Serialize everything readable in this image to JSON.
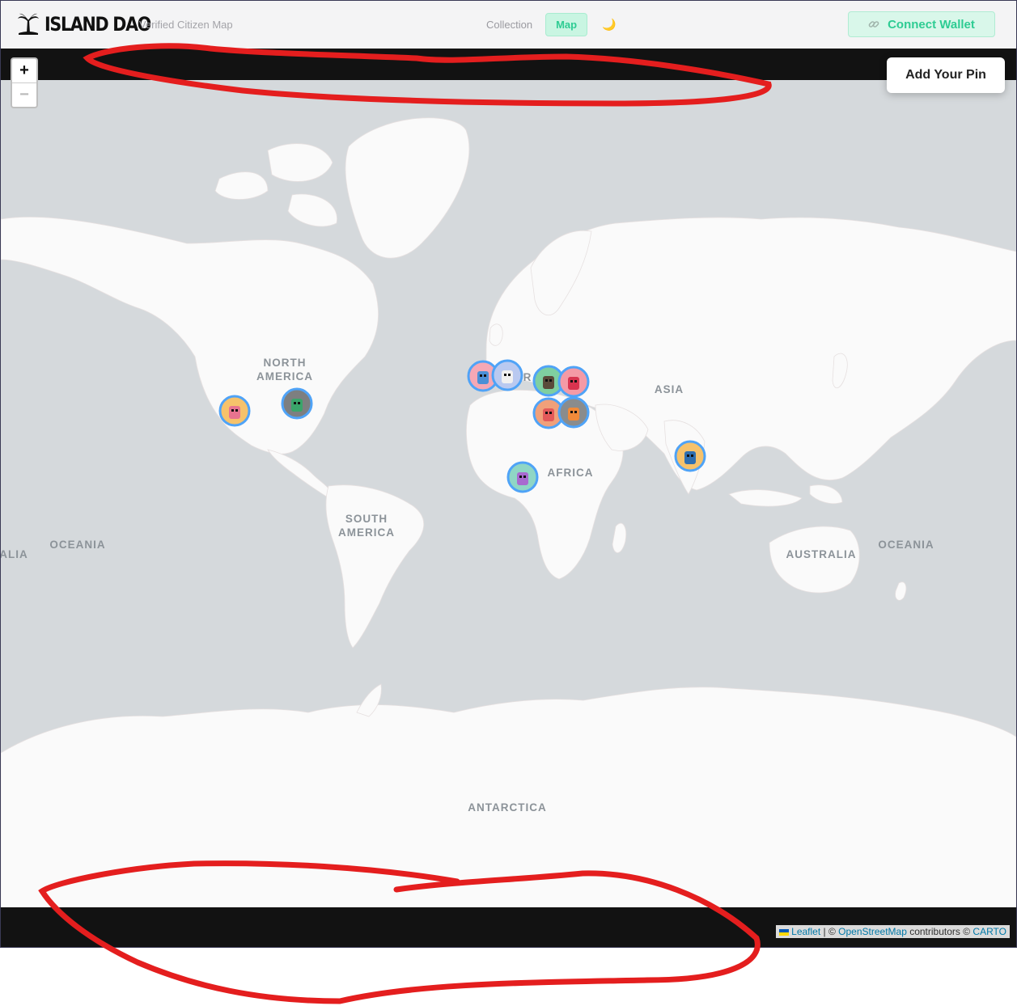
{
  "header": {
    "brand": "ISLAND DAO",
    "tagline": "Verified Citizen Map",
    "nav": {
      "collection": "Collection",
      "map": "Map"
    },
    "wallet_label": "Connect Wallet"
  },
  "map_controls": {
    "zoom_in": "+",
    "zoom_out": "−",
    "add_pin": "Add Your Pin"
  },
  "labels": {
    "north_america_1": "NORTH",
    "north_america_2": "AMERICA",
    "south_america_1": "SOUTH",
    "south_america_2": "AMERICA",
    "asia": "ASIA",
    "africa": "AFRICA",
    "oceania": "OCEANIA",
    "australia": "AUSTRALIA",
    "alia": "ALIA",
    "antarctica": "ANTARCTICA",
    "europe_partial": "R"
  },
  "attribution": {
    "leaflet": "Leaflet",
    "sep": " | © ",
    "osm": "OpenStreetMap",
    "contributors": " contributors © ",
    "carto": "CARTO"
  },
  "pins": [
    {
      "name": "pin-california",
      "bg": "#f6c26b",
      "body": "#e8738f"
    },
    {
      "name": "pin-texas",
      "bg": "#7d7f80",
      "body": "#3aa56a"
    },
    {
      "name": "pin-spain",
      "bg": "#f5a8b5",
      "body": "#4b8fd6"
    },
    {
      "name": "pin-france",
      "bg": "#b9c9f0",
      "body": "#f0f0f0"
    },
    {
      "name": "pin-italy",
      "bg": "#7fcfa0",
      "body": "#5a4a3a"
    },
    {
      "name": "pin-greece",
      "bg": "#f49aa6",
      "body": "#d8344f"
    },
    {
      "name": "pin-libya",
      "bg": "#f0a07a",
      "body": "#e35a5a"
    },
    {
      "name": "pin-egypt",
      "bg": "#8a8c8d",
      "body": "#f08a3a"
    },
    {
      "name": "pin-nigeria",
      "bg": "#8fd6c5",
      "body": "#a86ad0"
    },
    {
      "name": "pin-india",
      "bg": "#f6c26b",
      "body": "#2f6fb0"
    }
  ],
  "colors": {
    "accent": "#2ecc93",
    "water": "#d5d9dc",
    "land": "#fafafa",
    "pin_border": "#4fa3f7",
    "annotation": "#e41e1e"
  }
}
